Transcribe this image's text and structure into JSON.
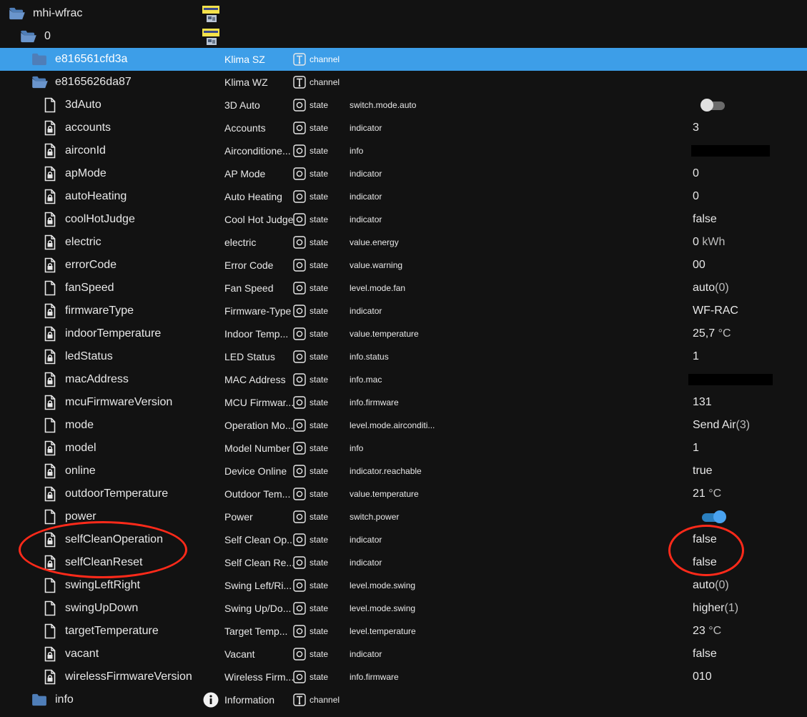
{
  "tree": {
    "root": {
      "name": "mhi-wfrac"
    },
    "instance": {
      "name": "0"
    },
    "channel1": {
      "name": "e816561cfd3a",
      "display": "Klima SZ",
      "type": "channel"
    },
    "channel2": {
      "name": "e8165626da87",
      "display": "Klima WZ",
      "type": "channel"
    },
    "states": [
      {
        "name": "3dAuto",
        "display": "3D Auto",
        "type": "state",
        "role": "switch.mode.auto",
        "value": "",
        "toggle": "off",
        "writable": true
      },
      {
        "name": "accounts",
        "display": "Accounts",
        "type": "state",
        "role": "indicator",
        "value": "3",
        "writable": false
      },
      {
        "name": "airconId",
        "display": "Airconditione...",
        "type": "state",
        "role": "info",
        "value": "",
        "redacted": true,
        "writable": false
      },
      {
        "name": "apMode",
        "display": "AP Mode",
        "type": "state",
        "role": "indicator",
        "value": "0",
        "writable": false
      },
      {
        "name": "autoHeating",
        "display": "Auto Heating",
        "type": "state",
        "role": "indicator",
        "value": "0",
        "writable": false
      },
      {
        "name": "coolHotJudge",
        "display": "Cool Hot Judge",
        "type": "state",
        "role": "indicator",
        "value": "false",
        "writable": false
      },
      {
        "name": "electric",
        "display": "electric",
        "type": "state",
        "role": "value.energy",
        "value": "0",
        "unit": "kWh",
        "writable": false
      },
      {
        "name": "errorCode",
        "display": "Error Code",
        "type": "state",
        "role": "value.warning",
        "value": "00",
        "writable": false
      },
      {
        "name": "fanSpeed",
        "display": "Fan Speed",
        "type": "state",
        "role": "level.mode.fan",
        "value": "auto",
        "num": "(0)",
        "writable": true
      },
      {
        "name": "firmwareType",
        "display": "Firmware-Type",
        "type": "state",
        "role": "indicator",
        "value": "WF-RAC",
        "writable": false
      },
      {
        "name": "indoorTemperature",
        "display": "Indoor Temp...",
        "type": "state",
        "role": "value.temperature",
        "value": "25,7",
        "unit": "°C",
        "writable": false
      },
      {
        "name": "ledStatus",
        "display": "LED Status",
        "type": "state",
        "role": "info.status",
        "value": "1",
        "writable": false
      },
      {
        "name": "macAddress",
        "display": "MAC Address",
        "type": "state",
        "role": "info.mac",
        "value": "",
        "redacted": true,
        "writable": false
      },
      {
        "name": "mcuFirmwareVersion",
        "display": "MCU Firmwar...",
        "type": "state",
        "role": "info.firmware",
        "value": "131",
        "writable": false
      },
      {
        "name": "mode",
        "display": "Operation Mo...",
        "type": "state",
        "role": "level.mode.airconditi...",
        "value": "Send Air",
        "num": "(3)",
        "writable": true
      },
      {
        "name": "model",
        "display": "Model Number",
        "type": "state",
        "role": "info",
        "value": "1",
        "writable": false
      },
      {
        "name": "online",
        "display": "Device Online",
        "type": "state",
        "role": "indicator.reachable",
        "value": "true",
        "writable": false
      },
      {
        "name": "outdoorTemperature",
        "display": "Outdoor Tem...",
        "type": "state",
        "role": "value.temperature",
        "value": "21",
        "unit": "°C",
        "writable": false
      },
      {
        "name": "power",
        "display": "Power",
        "type": "state",
        "role": "switch.power",
        "value": "",
        "toggle": "on",
        "writable": true
      },
      {
        "name": "selfCleanOperation",
        "display": "Self Clean Op...",
        "type": "state",
        "role": "indicator",
        "value": "false",
        "writable": false
      },
      {
        "name": "selfCleanReset",
        "display": "Self Clean Re...",
        "type": "state",
        "role": "indicator",
        "value": "false",
        "writable": false
      },
      {
        "name": "swingLeftRight",
        "display": "Swing Left/Ri...",
        "type": "state",
        "role": "level.mode.swing",
        "value": "auto",
        "num": "(0)",
        "writable": true
      },
      {
        "name": "swingUpDown",
        "display": "Swing Up/Do...",
        "type": "state",
        "role": "level.mode.swing",
        "value": "higher",
        "num": "(1)",
        "writable": true
      },
      {
        "name": "targetTemperature",
        "display": "Target Temp...",
        "type": "state",
        "role": "level.temperature",
        "value": "23",
        "unit": "°C",
        "writable": true
      },
      {
        "name": "vacant",
        "display": "Vacant",
        "type": "state",
        "role": "indicator",
        "value": "false",
        "writable": false
      },
      {
        "name": "wirelessFirmwareVersion",
        "display": "Wireless Firm...",
        "type": "state",
        "role": "info.firmware",
        "value": "010",
        "writable": false
      }
    ],
    "info": {
      "name": "info",
      "display": "Information",
      "type": "channel"
    }
  },
  "colors": {
    "background": "#121212",
    "selected_row": "#3d9ee8",
    "folder": "#4f7eb8",
    "toggle_on": "#4aa3f0",
    "annotation": "#ff2a1a"
  },
  "icons": {
    "folder": "folder-icon",
    "file": "file-icon",
    "lock_file": "locked-file-icon",
    "state": "state-circle-icon",
    "channel": "channel-icon",
    "adapter": "adapter-icon",
    "info": "info-circle-icon"
  }
}
